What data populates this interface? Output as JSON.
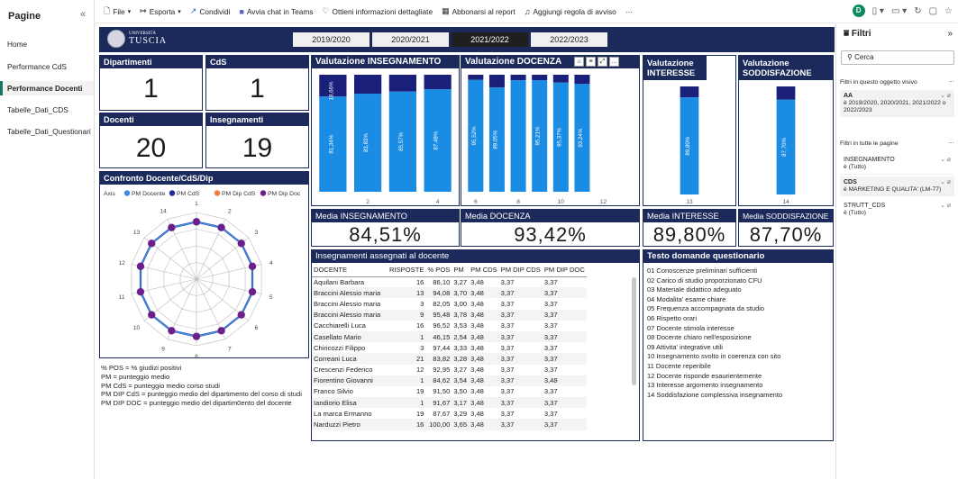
{
  "pages": {
    "title": "Pagine",
    "collapse_icon": "chevron-left-double",
    "items": [
      "Home",
      "Performance CdS",
      "Performance Docenti",
      "Tabelle_Dati_CDS",
      "Tabelle_Dati_Questionari"
    ]
  },
  "toolbar": {
    "file": "File",
    "export": "Esporta",
    "share": "Condividi",
    "teams": "Avvia chat in Teams",
    "insights": "Ottieni informazioni dettagliate",
    "subscribe": "Abbonarsi al report",
    "alert": "Aggiungi regola di avviso",
    "more": "···",
    "avatar": "D"
  },
  "banner": {
    "logo_line1": "UNIVERSITÀ",
    "logo_line2": "TUSCIA",
    "years": [
      "2019/2020",
      "2020/2021",
      "2021/2022",
      "2022/2023"
    ],
    "selected_year": "2021/2022"
  },
  "kpi": {
    "dipartimenti_label": "Dipartimenti",
    "dipartimenti": "1",
    "cds_label": "CdS",
    "cds": "1",
    "docenti_label": "Docenti",
    "docenti": "20",
    "insegnamenti_label": "Insegnamenti",
    "insegnamenti": "19"
  },
  "radar": {
    "title": "Confronto Docente/CdS/Dip",
    "axis_label": "Axis",
    "legend": [
      "PM Docente",
      "PM CdS",
      "PM Dip CdS",
      "PM Dip Doc"
    ],
    "legend_colors": [
      "#3b8fe0",
      "#1f2fa0",
      "#f07e3a",
      "#6a1f8a"
    ],
    "axes": [
      "1",
      "2",
      "3",
      "4",
      "5",
      "6",
      "7",
      "8",
      "9",
      "10",
      "11",
      "12",
      "13",
      "14"
    ]
  },
  "glossary": [
    "% POS    = % giudizi positivi",
    "PM        = punteggio medio",
    "PM CdS   = punteggio medio corso studi",
    "PM DIP CdS   = punteggio medio del dipartimento del corso di studi",
    "PM DIP DOC   = punteggio medio del dipartim0ento del docente"
  ],
  "chart_data": [
    {
      "type": "bar",
      "title": "Valutazione INSEGNAMENTO",
      "categories": [
        "1",
        "2",
        "3",
        "4"
      ],
      "tick_labels": [
        "",
        "2",
        "",
        "4"
      ],
      "series": [
        {
          "values": [
            81.34,
            83.83,
            85.57,
            87.48
          ]
        }
      ],
      "value_labels": [
        "81,34%",
        "83,83%",
        "85,57%",
        "87,48%"
      ],
      "top_label": "18,66%",
      "ylim": [
        0,
        100
      ],
      "colors": [
        "#1b8ce3",
        "#1a1f7a"
      ]
    },
    {
      "type": "bar",
      "title": "Valutazione DOCENZA",
      "categories": [
        "5",
        "6",
        "7",
        "8",
        "9",
        "10",
        "11",
        "12"
      ],
      "tick_labels": [
        "6",
        "",
        "8",
        "",
        "10",
        "",
        "12",
        ""
      ],
      "series": [
        {
          "values": [
            95.52,
            89.05,
            95.21,
            95.37,
            93.24,
            92.05,
            0,
            0
          ]
        }
      ],
      "value_labels": [
        "95,52%",
        "89,05%",
        "",
        "95,21%",
        "95,37%",
        "93,24%",
        "92,05%",
        ""
      ],
      "ylim": [
        0,
        100
      ],
      "colors": [
        "#1b8ce3",
        "#1a1f7a"
      ]
    },
    {
      "type": "bar",
      "title": "Valutazione INTERESSE",
      "categories": [
        "13"
      ],
      "series": [
        {
          "values": [
            89.8
          ]
        }
      ],
      "value_labels": [
        "89,80%"
      ],
      "ylim": [
        0,
        100
      ]
    },
    {
      "type": "bar",
      "title": "Valutazione SODDISFAZIONE",
      "categories": [
        "14"
      ],
      "series": [
        {
          "values": [
            87.7
          ]
        }
      ],
      "value_labels": [
        "87,70%"
      ],
      "ylim": [
        0,
        100
      ]
    }
  ],
  "medie": {
    "insegnamento_label": "Media INSEGNAMENTO",
    "insegnamento": "84,51%",
    "docenza_label": "Media DOCENZA",
    "docenza": "93,42%",
    "interesse_label": "Media INTERESSE",
    "interesse": "89,80%",
    "soddisfazione_label": "Media SODDISFAZIONE",
    "soddisfazione": "87,70%"
  },
  "table": {
    "title": "Insegnamenti assegnati al docente",
    "columns": [
      "DOCENTE",
      "RISPOSTE",
      "% POS",
      "PM",
      "PM CDS",
      "PM DIP CDS",
      "PM DIP DOC"
    ],
    "rows": [
      [
        "Aquilani Barbara",
        "16",
        "86,10",
        "3,27",
        "3,48",
        "3,37",
        "3,37"
      ],
      [
        "Braccini Alessio maria",
        "13",
        "94,08",
        "3,70",
        "3,48",
        "3,37",
        "3,37"
      ],
      [
        "Braccini Alessio maria",
        "3",
        "82,05",
        "3,00",
        "3,48",
        "3,37",
        "3,37"
      ],
      [
        "Braccini Alessio maria",
        "9",
        "95,48",
        "3,78",
        "3,48",
        "3,37",
        "3,37"
      ],
      [
        "Cacchiarelli Luca",
        "16",
        "96,52",
        "3,53",
        "3,48",
        "3,37",
        "3,37"
      ],
      [
        "Casellato Mario",
        "1",
        "46,15",
        "2,54",
        "3,48",
        "3,37",
        "3,37"
      ],
      [
        "Chiricozzi Filippo",
        "3",
        "97,44",
        "3,33",
        "3,48",
        "3,37",
        "3,37"
      ],
      [
        "Correani Luca",
        "21",
        "83,82",
        "3,28",
        "3,48",
        "3,37",
        "3,37"
      ],
      [
        "Crescenzi Federico",
        "12",
        "92,95",
        "3,27",
        "3,48",
        "3,37",
        "3,37"
      ],
      [
        "Fiorentino Giovanni",
        "1",
        "84,62",
        "3,54",
        "3,48",
        "3,37",
        "3,48"
      ],
      [
        "Franco Silvio",
        "19",
        "91,50",
        "3,50",
        "3,48",
        "3,37",
        "3,37"
      ],
      [
        "Iandiorio Elisa",
        "1",
        "91,67",
        "3,17",
        "3,48",
        "3,37",
        "3,37"
      ],
      [
        "La marca Ermanno",
        "19",
        "87,67",
        "3,29",
        "3,48",
        "3,37",
        "3,37"
      ],
      [
        "Narduzzi Pietro",
        "16",
        "100,00",
        "3,65",
        "3,48",
        "3,37",
        "3,37"
      ]
    ]
  },
  "questions": {
    "title": "Testo domande questionario",
    "items": [
      "01 Conoscenze preliminari sufficienti",
      "02 Carico di studio proporzionato CFU",
      "03 Materiale didattico adeguato",
      "04 Modalita' esame chiare",
      "05 Frequenza accompagnata da studio",
      "06 Rispetto orari",
      "07 Docente stimola interesse",
      "08 Docente chiaro nell'esposizione",
      "09 Attivita' integrative utili",
      "10 Insegnamento svolto in coerenza con sito",
      "11 Docente reperibile",
      "12 Docente risponde esaurientemente",
      "13 Interesse argomento insegnamento",
      "14 Soddisfazione complessiva insegnamento"
    ]
  },
  "filters": {
    "title": "Filtri",
    "search_placeholder": "Cerca",
    "visual_section": "Filtri in questo oggetto visivo",
    "all_pages_section": "Filtri in tutte le pagine",
    "aa_title": "AA",
    "aa_value": "è 2019/2020, 2020/2021, 2021/2022 o 2022/2023",
    "ins_title": "INSEGNAMENTO",
    "ins_value": "è (Tutto)",
    "cds_title": "CDS",
    "cds_value": "è MARKETING E QUALITA' (LM-77)",
    "strutt_title": "STRUTT_CDS",
    "strutt_value": "è (Tutto)"
  }
}
